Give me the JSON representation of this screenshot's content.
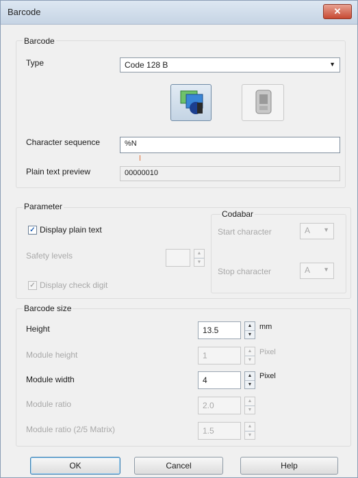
{
  "window": {
    "title": "Barcode",
    "close_glyph": "✕"
  },
  "barcode_group": {
    "label": "Barcode",
    "type_label": "Type",
    "type_value": "Code 128 B",
    "char_seq_label": "Character sequence",
    "char_seq_value": "%N",
    "preview_label": "Plain text preview",
    "preview_value": "00000010",
    "icons": [
      "barcode-scanner-icon",
      "handheld-scanner-icon"
    ]
  },
  "parameter_group": {
    "label": "Parameter",
    "display_plain_text": "Display plain text",
    "display_plain_text_checked": true,
    "safety_levels": "Safety levels",
    "display_check_digit": "Display check digit",
    "display_check_digit_checked": true
  },
  "codabar_group": {
    "label": "Codabar",
    "start_label": "Start character",
    "start_value": "A",
    "stop_label": "Stop character",
    "stop_value": "A"
  },
  "size_group": {
    "label": "Barcode size",
    "height_label": "Height",
    "height_value": "13.5",
    "height_unit": "mm",
    "module_height_label": "Module height",
    "module_height_value": "1",
    "module_height_unit": "Pixel",
    "module_width_label": "Module width",
    "module_width_value": "4",
    "module_width_unit": "Pixel",
    "module_ratio_label": "Module ratio",
    "module_ratio_value": "2.0",
    "module_ratio_25_label": "Module ratio (2/5 Matrix)",
    "module_ratio_25_value": "1.5"
  },
  "buttons": {
    "ok": "OK",
    "cancel": "Cancel",
    "help": "Help"
  },
  "spin_glyphs": {
    "up": "▲",
    "down": "▼"
  },
  "check_glyph": "✓",
  "dropdown_glyph": "▼"
}
